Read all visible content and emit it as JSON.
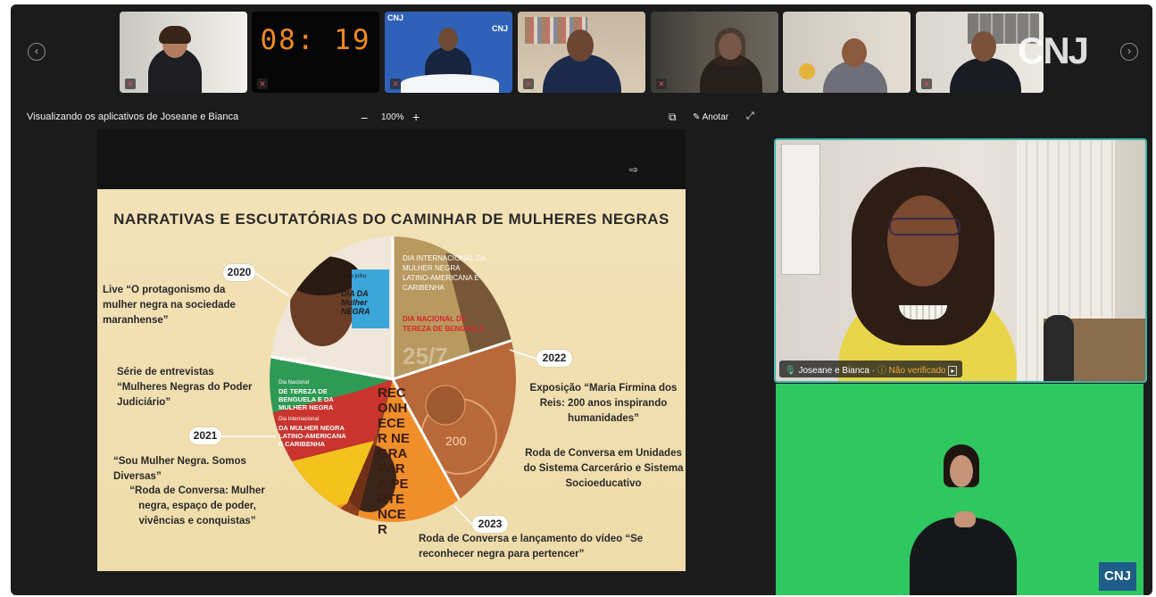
{
  "strip": {
    "prev_icon": "chevron-left-icon",
    "next_icon": "chevron-right-icon",
    "clock_time": "08: 19",
    "logo_text": "CNJ",
    "thumb_logo_left": "CNJ",
    "thumb_logo_right": "CNJ"
  },
  "toolbar": {
    "viewing_label": "Visualizando os aplicativos de Joseane e Bianca",
    "zoom_minus": "−",
    "zoom_level": "100%",
    "zoom_plus": "+",
    "annotate_label": "Anotar"
  },
  "slide": {
    "title": "NARRATIVAS E ESCUTATÓRIAS DO CAMINHAR DE MULHERES NEGRAS",
    "years": {
      "y2020": "2020",
      "y2021": "2021",
      "y2022": "2022",
      "y2023": "2023"
    },
    "text_2020": "Live “O protagonismo da mulher negra na sociedade maranhense”",
    "text_2020_b": "Série de entrevistas “Mulheres Negras do Poder Judiciário”",
    "text_2021_a": "“Sou Mulher Negra. Somos Diversas”",
    "text_2021_b": "“Roda de Conversa: Mulher negra, espaço de poder, vivências e conquistas”",
    "text_2022_a": "Exposição “Maria Firmina dos Reis: 200 anos inspirando humanidades”",
    "text_2022_b": "Roda de Conversa em Unidades do Sistema Carcerário e Sistema Socioeducativo",
    "text_2023": "Roda de Conversa e lançamento do vídeo “Se reconhecer negra para pertencer”",
    "poster1": "DIA DA Mulher NEGRA",
    "poster1_small": "25 de julho",
    "poster2": "DIA INTERNACIONAL DA MULHER NEGRA LATINO-AMERICANA E CARIBENHA",
    "poster2_b": "DIA NACIONAL DE TEREZA DE BENGUELA",
    "poster2_date": "25/7",
    "poster3_small": "25 de julho",
    "poster3_a": "Dia Nacional",
    "poster3_b": "DE TEREZA DE BENGUELA E DA MULHER NEGRA",
    "poster3_c": "Dia Internacional",
    "poster3_d": "DA MULHER NEGRA LATINO-AMERICANA E CARIBENHA",
    "poster4": "RECONHECER NEGRA PARA PERTENCER",
    "poster5": "200"
  },
  "speaker": {
    "name": "Joseane e Bianca",
    "status": "Não verificado"
  },
  "colors": {
    "frame": "#1b1b1b",
    "speaker_border": "#3fb5a8",
    "chroma_green": "#2ec760",
    "clock": "#f08a1c"
  }
}
